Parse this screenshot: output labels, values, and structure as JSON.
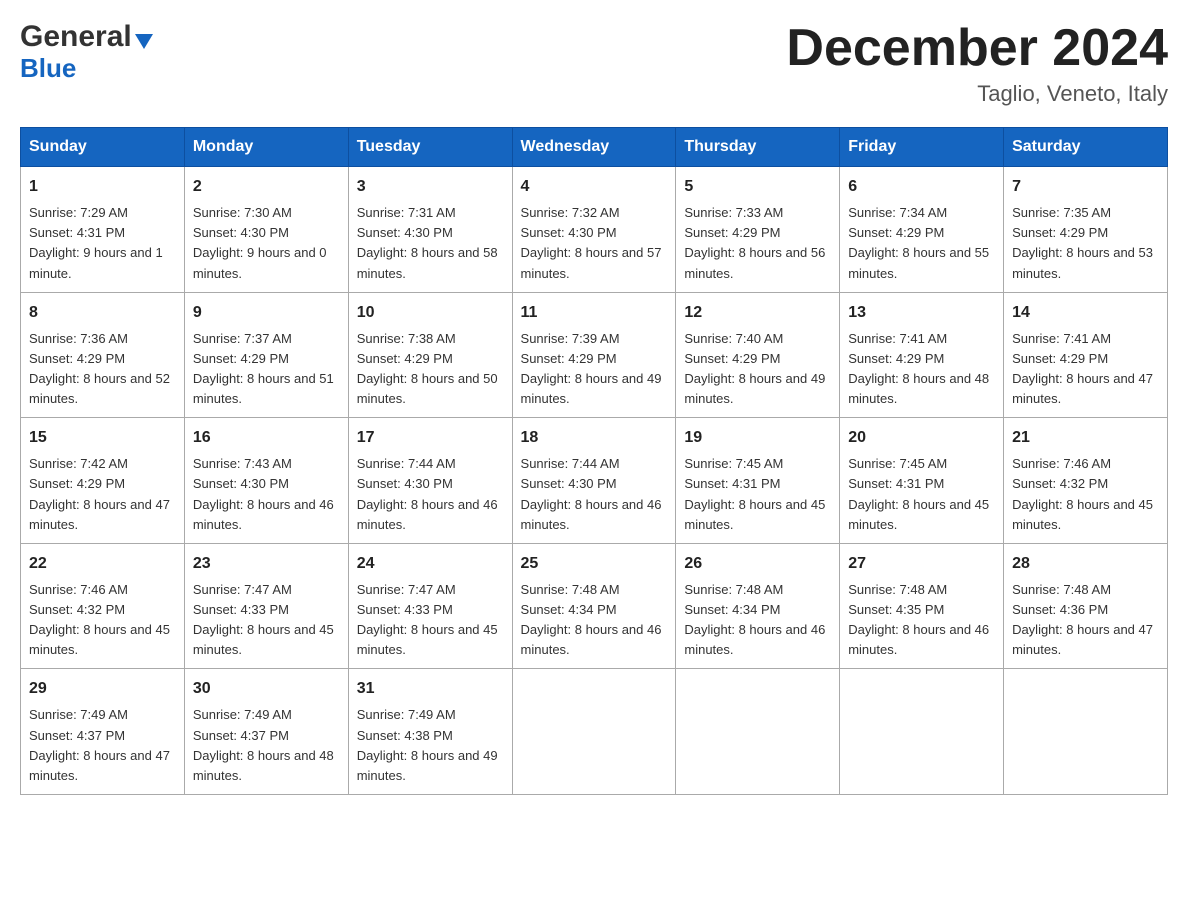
{
  "header": {
    "logo_general": "General",
    "logo_blue": "Blue",
    "month_title": "December 2024",
    "location": "Taglio, Veneto, Italy"
  },
  "days_of_week": [
    "Sunday",
    "Monday",
    "Tuesday",
    "Wednesday",
    "Thursday",
    "Friday",
    "Saturday"
  ],
  "weeks": [
    [
      {
        "day": "1",
        "sunrise": "7:29 AM",
        "sunset": "4:31 PM",
        "daylight": "9 hours and 1 minute."
      },
      {
        "day": "2",
        "sunrise": "7:30 AM",
        "sunset": "4:30 PM",
        "daylight": "9 hours and 0 minutes."
      },
      {
        "day": "3",
        "sunrise": "7:31 AM",
        "sunset": "4:30 PM",
        "daylight": "8 hours and 58 minutes."
      },
      {
        "day": "4",
        "sunrise": "7:32 AM",
        "sunset": "4:30 PM",
        "daylight": "8 hours and 57 minutes."
      },
      {
        "day": "5",
        "sunrise": "7:33 AM",
        "sunset": "4:29 PM",
        "daylight": "8 hours and 56 minutes."
      },
      {
        "day": "6",
        "sunrise": "7:34 AM",
        "sunset": "4:29 PM",
        "daylight": "8 hours and 55 minutes."
      },
      {
        "day": "7",
        "sunrise": "7:35 AM",
        "sunset": "4:29 PM",
        "daylight": "8 hours and 53 minutes."
      }
    ],
    [
      {
        "day": "8",
        "sunrise": "7:36 AM",
        "sunset": "4:29 PM",
        "daylight": "8 hours and 52 minutes."
      },
      {
        "day": "9",
        "sunrise": "7:37 AM",
        "sunset": "4:29 PM",
        "daylight": "8 hours and 51 minutes."
      },
      {
        "day": "10",
        "sunrise": "7:38 AM",
        "sunset": "4:29 PM",
        "daylight": "8 hours and 50 minutes."
      },
      {
        "day": "11",
        "sunrise": "7:39 AM",
        "sunset": "4:29 PM",
        "daylight": "8 hours and 49 minutes."
      },
      {
        "day": "12",
        "sunrise": "7:40 AM",
        "sunset": "4:29 PM",
        "daylight": "8 hours and 49 minutes."
      },
      {
        "day": "13",
        "sunrise": "7:41 AM",
        "sunset": "4:29 PM",
        "daylight": "8 hours and 48 minutes."
      },
      {
        "day": "14",
        "sunrise": "7:41 AM",
        "sunset": "4:29 PM",
        "daylight": "8 hours and 47 minutes."
      }
    ],
    [
      {
        "day": "15",
        "sunrise": "7:42 AM",
        "sunset": "4:29 PM",
        "daylight": "8 hours and 47 minutes."
      },
      {
        "day": "16",
        "sunrise": "7:43 AM",
        "sunset": "4:30 PM",
        "daylight": "8 hours and 46 minutes."
      },
      {
        "day": "17",
        "sunrise": "7:44 AM",
        "sunset": "4:30 PM",
        "daylight": "8 hours and 46 minutes."
      },
      {
        "day": "18",
        "sunrise": "7:44 AM",
        "sunset": "4:30 PM",
        "daylight": "8 hours and 46 minutes."
      },
      {
        "day": "19",
        "sunrise": "7:45 AM",
        "sunset": "4:31 PM",
        "daylight": "8 hours and 45 minutes."
      },
      {
        "day": "20",
        "sunrise": "7:45 AM",
        "sunset": "4:31 PM",
        "daylight": "8 hours and 45 minutes."
      },
      {
        "day": "21",
        "sunrise": "7:46 AM",
        "sunset": "4:32 PM",
        "daylight": "8 hours and 45 minutes."
      }
    ],
    [
      {
        "day": "22",
        "sunrise": "7:46 AM",
        "sunset": "4:32 PM",
        "daylight": "8 hours and 45 minutes."
      },
      {
        "day": "23",
        "sunrise": "7:47 AM",
        "sunset": "4:33 PM",
        "daylight": "8 hours and 45 minutes."
      },
      {
        "day": "24",
        "sunrise": "7:47 AM",
        "sunset": "4:33 PM",
        "daylight": "8 hours and 45 minutes."
      },
      {
        "day": "25",
        "sunrise": "7:48 AM",
        "sunset": "4:34 PM",
        "daylight": "8 hours and 46 minutes."
      },
      {
        "day": "26",
        "sunrise": "7:48 AM",
        "sunset": "4:34 PM",
        "daylight": "8 hours and 46 minutes."
      },
      {
        "day": "27",
        "sunrise": "7:48 AM",
        "sunset": "4:35 PM",
        "daylight": "8 hours and 46 minutes."
      },
      {
        "day": "28",
        "sunrise": "7:48 AM",
        "sunset": "4:36 PM",
        "daylight": "8 hours and 47 minutes."
      }
    ],
    [
      {
        "day": "29",
        "sunrise": "7:49 AM",
        "sunset": "4:37 PM",
        "daylight": "8 hours and 47 minutes."
      },
      {
        "day": "30",
        "sunrise": "7:49 AM",
        "sunset": "4:37 PM",
        "daylight": "8 hours and 48 minutes."
      },
      {
        "day": "31",
        "sunrise": "7:49 AM",
        "sunset": "4:38 PM",
        "daylight": "8 hours and 49 minutes."
      },
      null,
      null,
      null,
      null
    ]
  ],
  "labels": {
    "sunrise": "Sunrise:",
    "sunset": "Sunset:",
    "daylight": "Daylight:"
  }
}
